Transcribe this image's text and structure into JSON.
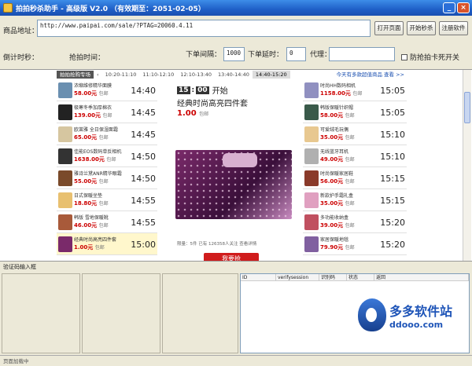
{
  "window": {
    "title": "拍拍秒杀助手 - 高级版 V2.0 （有效期至：2051-02-05）"
  },
  "form": {
    "url_label": "商品地址：",
    "url_value": "http://www.paipai.com/sale/?PTAG=20060.4.11",
    "countdown_label": "倒计时秒：",
    "grab_time_label": "抢拍时间：",
    "interval_label": "下单间隔：",
    "interval_value": "1000",
    "timeout_label": "下单延时：",
    "timeout_value": "0",
    "proxy_label": "代理：",
    "proxy_value": "",
    "anti_freeze_label": "防抢拍卡死开关",
    "anti_freeze_checked": false
  },
  "buttons": {
    "open_page": "打开页面",
    "start": "开始秒杀",
    "register": "注册软件"
  },
  "browser": {
    "category_tab": "拍拍抢购专场",
    "time_tabs": [
      "10:20-11:10",
      "11:10-12:10",
      "12:10-13:40",
      "13:40-14:40",
      "14:40-15:20"
    ],
    "active_tab_index": 4,
    "more_link": "今天有多款超值商品 查看 >>",
    "left_items": [
      {
        "name": "浓缩维修精华面膜",
        "price": "58.00元",
        "sold": "包邮",
        "time": "14:40",
        "color": "#6a8fb0"
      },
      {
        "name": "极寒冬季加厚棉衣",
        "price": "139.00元",
        "sold": "包邮",
        "time": "14:45",
        "color": "#222222"
      },
      {
        "name": "欧莱雅 全日保湿面霜",
        "price": "65.00元",
        "sold": "包邮",
        "time": "14:45",
        "color": "#d6c6a0"
      },
      {
        "name": "佳能EOS数码单反相机",
        "price": "1638.00元",
        "sold": "包邮",
        "time": "14:50",
        "color": "#333333"
      },
      {
        "name": "雅诗兰黛ANR精华眼霜",
        "price": "55.00元",
        "sold": "包邮",
        "time": "14:50",
        "color": "#7a4a2a"
      },
      {
        "name": "日式保暖坐垫",
        "price": "18.80元",
        "sold": "包邮",
        "time": "14:55",
        "color": "#e8c070"
      },
      {
        "name": "韩版 雪地保暖靴",
        "price": "46.00元",
        "sold": "包邮",
        "time": "14:55",
        "color": "#a85a3a"
      },
      {
        "name": "经典时尚高亮四件套",
        "price": "1.00元",
        "sold": "包邮",
        "time": "15:00",
        "color": "#7a2a6a",
        "highlight": true
      }
    ],
    "right_items": [
      {
        "name": "时尚HH数码相机",
        "price": "1158.00元",
        "sold": "包邮",
        "time": "15:05",
        "color": "#9090c0"
      },
      {
        "name": "韩版保暖针织帽",
        "price": "58.00元",
        "sold": "包邮",
        "time": "15:05",
        "color": "#3a5a4a"
      },
      {
        "name": "可爱绒毛玩偶",
        "price": "35.00元",
        "sold": "包邮",
        "time": "15:10",
        "color": "#e8c890"
      },
      {
        "name": "无线蓝牙耳机",
        "price": "49.00元",
        "sold": "包邮",
        "time": "15:10",
        "color": "#b0b0b0"
      },
      {
        "name": "时尚保暖家居鞋",
        "price": "56.00元",
        "sold": "包邮",
        "time": "15:15",
        "color": "#8a3a2a"
      },
      {
        "name": "新款护手霜礼盒",
        "price": "35.00元",
        "sold": "包邮",
        "time": "15:15",
        "color": "#e0a0c0"
      },
      {
        "name": "多功能收纳盒",
        "price": "39.00元",
        "sold": "包邮",
        "time": "15:20",
        "color": "#c05060"
      },
      {
        "name": "家居保暖地毯",
        "price": "79.90元",
        "sold": "包邮",
        "time": "15:20",
        "color": "#8060a0"
      }
    ],
    "featured": {
      "time_hh": "15",
      "time_mm": "00",
      "start_label": "开始",
      "title": "经典时尚高亮四件套",
      "price": "1.00",
      "price_note": "包邮",
      "meta": "限量：5件   已有 126358人关注   查看详情",
      "grab_button": "我要抢"
    }
  },
  "captcha": {
    "label": "验证码输入框"
  },
  "result_table": {
    "columns": [
      "ID",
      "verifysession",
      "识别码",
      "状态",
      "返回"
    ]
  },
  "status_bar": {
    "text": "页面加载中"
  },
  "watermark": {
    "zh": "多多软件站",
    "en": "ddooo.com"
  }
}
